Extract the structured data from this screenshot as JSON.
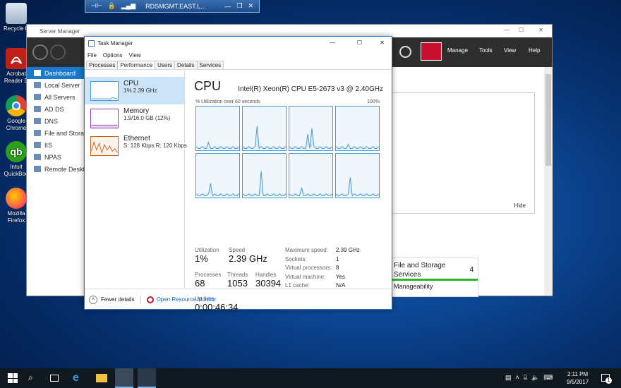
{
  "desktop": {
    "icons": [
      {
        "label": "Recycle Bin",
        "short": "Recycle B"
      },
      {
        "label": "Acrobat Reader DC",
        "line1": "Acrobat",
        "line2": "Reader D"
      },
      {
        "label": "Google Chrome",
        "line1": "Google",
        "line2": "Chrome"
      },
      {
        "label": "Intuit QuickBooks",
        "line1": "Intuit",
        "line2": "QuickBoo"
      },
      {
        "label": "Mozilla Firefox",
        "line1": "Mozilla",
        "line2": "Firefox"
      }
    ]
  },
  "rdp_bar": {
    "title": "RDSMGMT.EAST.L..."
  },
  "server_manager": {
    "title": "Server Manager",
    "menu": [
      "Manage",
      "Tools",
      "View",
      "Help"
    ],
    "nav": [
      "Dashboard",
      "Local Server",
      "All Servers",
      "AD DS",
      "DNS",
      "File and Storag",
      "IIS",
      "NPAS",
      "Remote Deskt"
    ],
    "hide_label": "Hide",
    "tile": {
      "title_line1": "File and Storage",
      "title_line2": "Services",
      "count": "4",
      "sub": "Manageability"
    }
  },
  "task_manager": {
    "title": "Task Manager",
    "menu": [
      "File",
      "Options",
      "View"
    ],
    "tabs": [
      "Processes",
      "Performance",
      "Users",
      "Details",
      "Services"
    ],
    "selected_tab": "Performance",
    "resources": [
      {
        "name": "CPU",
        "value": "1% 2.39 GHz",
        "color": "#4a9bd4"
      },
      {
        "name": "Memory",
        "value": "1.9/16.0 GB (12%)",
        "color": "#8b3ea8"
      },
      {
        "name": "Ethernet",
        "value": "S: 128 Kbps R: 120 Kbps",
        "color": "#c8641e"
      }
    ],
    "cpu": {
      "heading": "CPU",
      "model": "Intel(R) Xeon(R) CPU E5-2673 v3 @ 2.40GHz",
      "graph_label": "% Utilization over 60 seconds",
      "graph_max": "100%",
      "utilization_label": "Utilization",
      "utilization": "1%",
      "speed_label": "Speed",
      "speed": "2.39 GHz",
      "processes_label": "Processes",
      "processes": "68",
      "threads_label": "Threads",
      "threads": "1053",
      "handles_label": "Handles",
      "handles": "30394",
      "uptime_label": "Up time",
      "uptime": "0:00:46:34",
      "details": [
        {
          "k": "Maximum speed:",
          "v": "2.39 GHz"
        },
        {
          "k": "Sockets:",
          "v": "1"
        },
        {
          "k": "Virtual processors:",
          "v": "8"
        },
        {
          "k": "Virtual machine:",
          "v": "Yes"
        },
        {
          "k": "L1 cache:",
          "v": "N/A"
        }
      ]
    },
    "fewer_details": "Fewer details",
    "open_resource_monitor": "Open Resource Monitor"
  },
  "taskbar": {
    "time": "2:11 PM",
    "date": "9/5/2017",
    "notification_count": "1"
  }
}
